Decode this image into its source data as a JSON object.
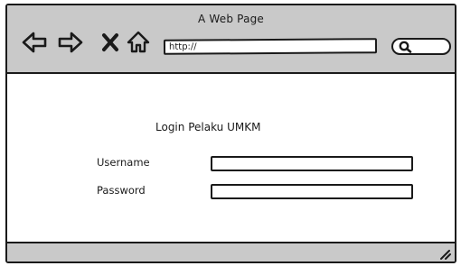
{
  "window": {
    "title": "A Web Page",
    "address_bar": {
      "value": "http://"
    },
    "search_icon": "search-icon",
    "nav_icons": [
      "back-arrow-icon",
      "forward-arrow-icon",
      "close-icon",
      "home-icon"
    ]
  },
  "login": {
    "heading": "Login Pelaku UMKM",
    "username_label": "Username",
    "username_value": "",
    "password_label": "Password",
    "password_value": ""
  },
  "colors": {
    "chrome_gray": "#c9c9c9",
    "ink": "#1a1a1a",
    "page_background": "#ffffff"
  }
}
